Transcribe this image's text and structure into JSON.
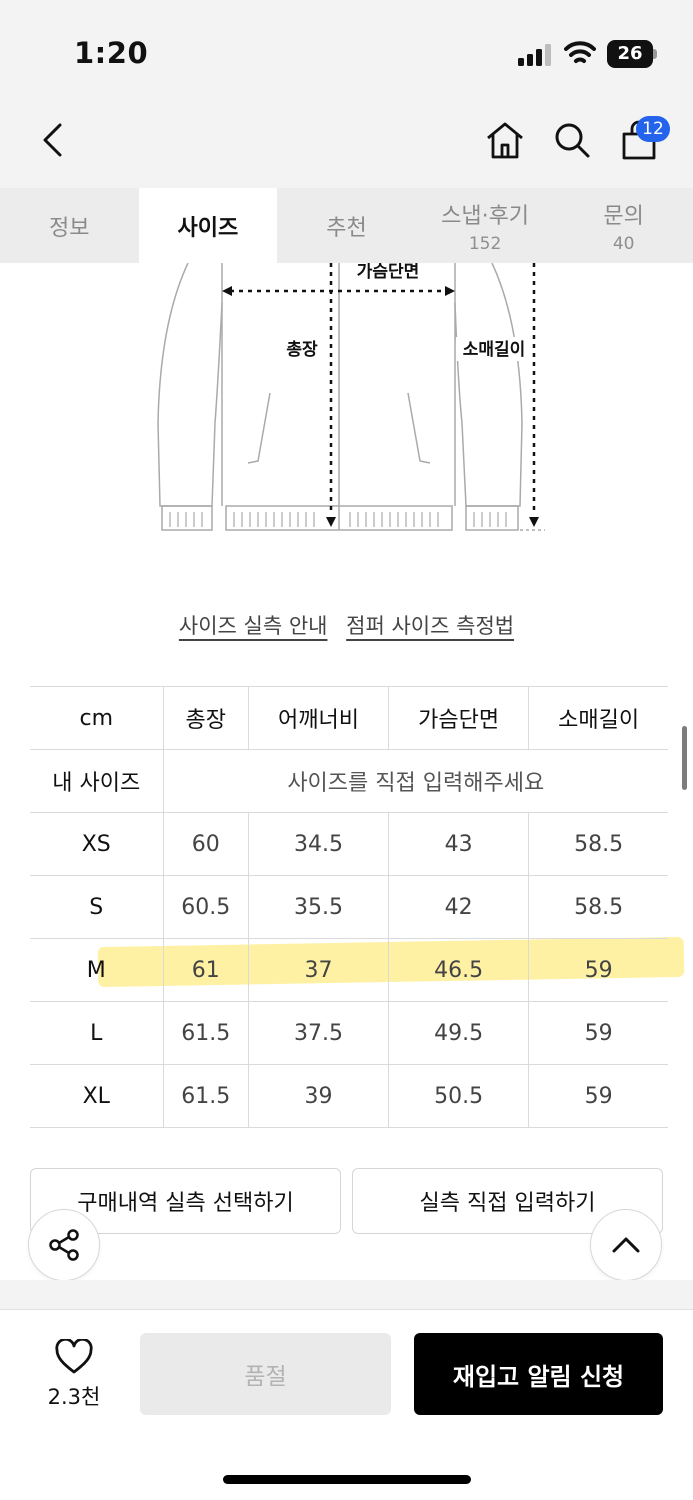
{
  "status_bar": {
    "time": "1:20",
    "battery": "26"
  },
  "header": {
    "cart_count": "12"
  },
  "tabs": [
    {
      "label": "정보",
      "count": ""
    },
    {
      "label": "사이즈",
      "count": ""
    },
    {
      "label": "추천",
      "count": ""
    },
    {
      "label": "스냅·후기",
      "count": "152"
    },
    {
      "label": "문의",
      "count": "40"
    }
  ],
  "active_tab": "사이즈",
  "illustration": {
    "chest_label": "가슴단면",
    "length_label": "총장",
    "sleeve_label": "소매길이"
  },
  "guides": {
    "measure_guide": "사이즈 실측 안내",
    "jumper_guide": "점퍼 사이즈 측정법"
  },
  "size_table": {
    "headers": [
      "cm",
      "총장",
      "어깨너비",
      "가슴단면",
      "소매길이"
    ],
    "my_size_label": "내 사이즈",
    "my_size_prompt": "사이즈를 직접 입력해주세요",
    "rows": [
      {
        "size": "XS",
        "values": [
          "60",
          "34.5",
          "43",
          "58.5"
        ]
      },
      {
        "size": "S",
        "values": [
          "60.5",
          "35.5",
          "42",
          "58.5"
        ]
      },
      {
        "size": "M",
        "values": [
          "61",
          "37",
          "46.5",
          "59"
        ]
      },
      {
        "size": "L",
        "values": [
          "61.5",
          "37.5",
          "49.5",
          "59"
        ]
      },
      {
        "size": "XL",
        "values": [
          "61.5",
          "39",
          "50.5",
          "59"
        ]
      }
    ],
    "highlighted_row": "M"
  },
  "actions": {
    "purchase_history": "구매내역 실측 선택하기",
    "manual_input": "실측 직접 입력하기"
  },
  "bottom_bar": {
    "like_count": "2.3천",
    "soldout": "품절",
    "restock": "재입고 알림 신청"
  },
  "colors": {
    "accent_badge": "#2463eb",
    "highlight": "#ffe65a",
    "primary_button": "#000000"
  }
}
